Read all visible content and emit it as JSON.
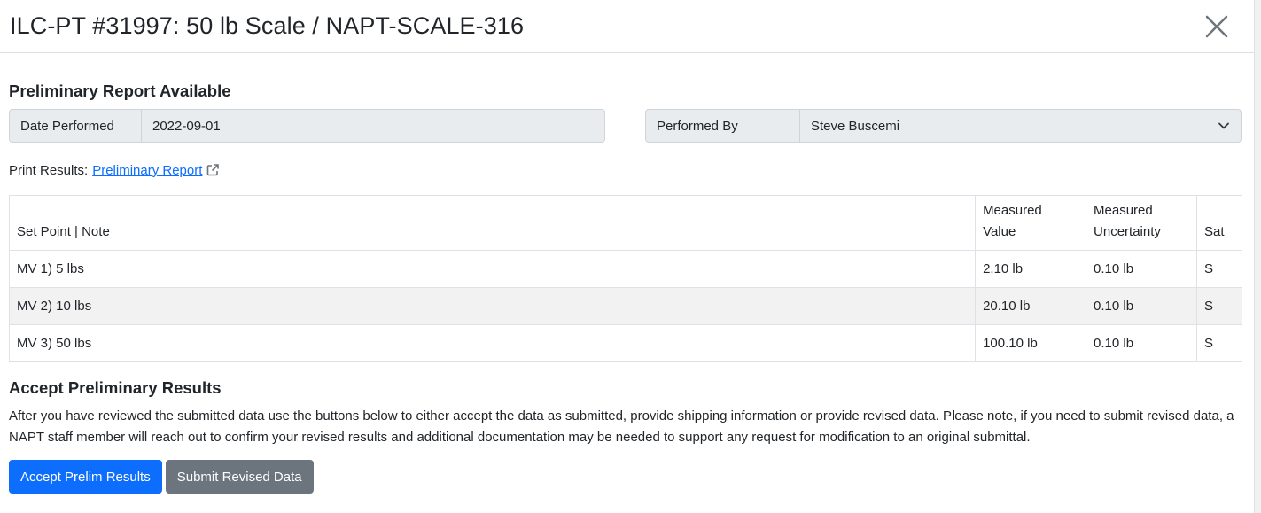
{
  "modal": {
    "title": "ILC-PT #31997: 50 lb Scale / NAPT-SCALE-316"
  },
  "report": {
    "heading": "Preliminary Report Available",
    "date_label": "Date Performed",
    "date_value": "2022-09-01",
    "performed_by_label": "Performed By",
    "performed_by_value": "Steve Buscemi",
    "print_label": "Print Results:",
    "print_link": "Preliminary Report"
  },
  "table": {
    "headers": {
      "set_point": "Set Point | Note",
      "measured_value_1": "Measured",
      "measured_value_2": "Value",
      "measured_unc_1": "Measured",
      "measured_unc_2": "Uncertainty",
      "sat": "Sat"
    },
    "rows": [
      {
        "set_point": "MV 1) 5 lbs",
        "value": "2.10 lb",
        "uncertainty": "0.10 lb",
        "sat": "S"
      },
      {
        "set_point": "MV 2) 10 lbs",
        "value": "20.10 lb",
        "uncertainty": "0.10 lb",
        "sat": "S"
      },
      {
        "set_point": "MV 3) 50 lbs",
        "value": "100.10 lb",
        "uncertainty": "0.10 lb",
        "sat": "S"
      }
    ]
  },
  "accept": {
    "heading": "Accept Preliminary Results",
    "text": "After you have reviewed the submitted data use the buttons below to either accept the data as submitted, provide shipping information or provide revised data. Please note, if you need to submit revised data, a NAPT staff member will reach out to confirm your revised results and additional documentation may be needed to support any request for modification to an original submittal.",
    "accept_button": "Accept Prelim Results",
    "revise_button": "Submit Revised Data"
  },
  "icons": {
    "close": "close-icon",
    "external_link": "external-link-icon",
    "dropdown": "chevron-down-icon"
  },
  "colors": {
    "primary": "#0d6efd",
    "secondary": "#6c757d",
    "input_bg": "#e9ecef",
    "border": "#dee2e6"
  }
}
